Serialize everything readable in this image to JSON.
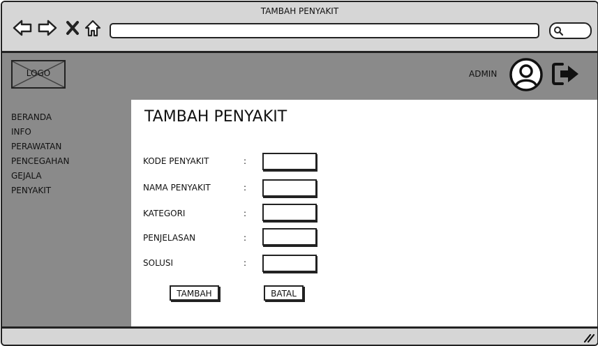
{
  "window": {
    "title": "TAMBAH PENYAKIT"
  },
  "browser": {
    "url": "",
    "nav_icons": [
      "back-arrow-icon",
      "forward-arrow-icon",
      "close-icon",
      "home-icon"
    ],
    "search_icon": "search-icon"
  },
  "header": {
    "logo_text": "LOGO",
    "user_label": "ADMIN",
    "avatar_icon": "user-avatar-icon",
    "logout_icon": "logout-icon"
  },
  "sidebar": {
    "items": [
      {
        "label": "BERANDA"
      },
      {
        "label": "INFO"
      },
      {
        "label": "PERAWATAN"
      },
      {
        "label": "PENCEGAHAN"
      },
      {
        "label": "GEJALA"
      },
      {
        "label": "PENYAKIT"
      }
    ]
  },
  "main": {
    "title": "TAMBAH PENYAKIT",
    "separator": ":",
    "fields": [
      {
        "label": "KODE PENYAKIT",
        "value": ""
      },
      {
        "label": "NAMA PENYAKIT",
        "value": ""
      },
      {
        "label": "KATEGORI",
        "value": ""
      },
      {
        "label": "PENJELASAN",
        "value": ""
      },
      {
        "label": "SOLUSI",
        "value": ""
      }
    ],
    "buttons": {
      "submit_label": "TAMBAH",
      "cancel_label": "BATAL"
    }
  },
  "colors": {
    "chrome": "#d6d6d6",
    "panel": "#8a8a8a",
    "content": "#ffffff",
    "stroke": "#222222"
  }
}
